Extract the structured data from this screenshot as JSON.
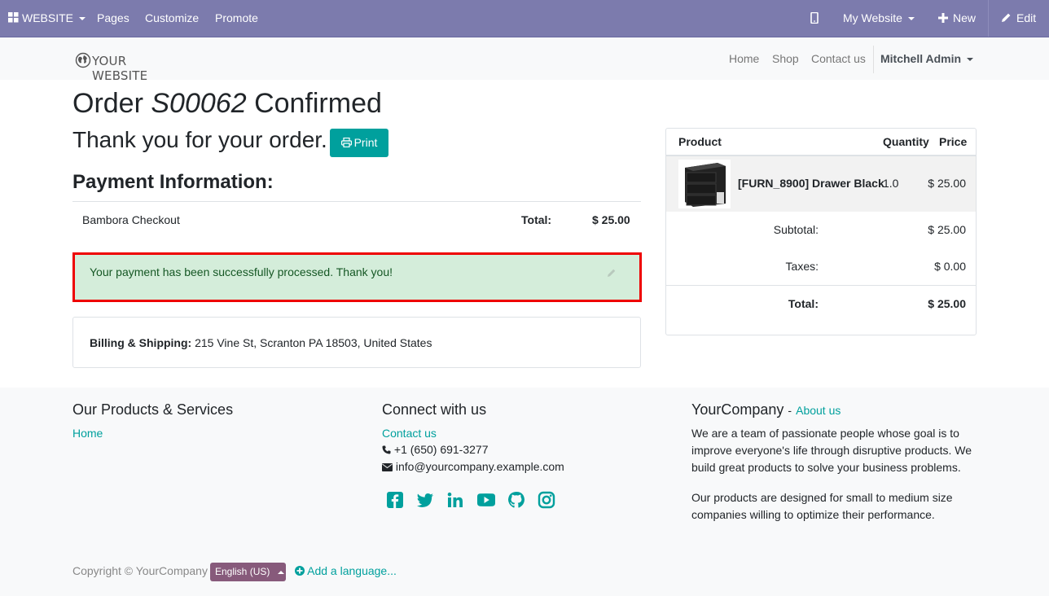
{
  "admin_bar": {
    "website_label": "WEBSITE",
    "pages_label": "Pages",
    "customize_label": "Customize",
    "promote_label": "Promote",
    "my_website_label": "My Website",
    "new_label": "New",
    "edit_label": "Edit"
  },
  "site_nav": {
    "logo_text": "YOUR WEBSITE",
    "links": [
      "Home",
      "Shop",
      "Contact us"
    ],
    "user_label": "Mitchell Admin"
  },
  "order": {
    "title_prefix": "Order",
    "order_number": "S00062",
    "title_suffix": "Confirmed",
    "thanks_text": "Thank you for your order.",
    "print_label": "Print"
  },
  "payment": {
    "heading": "Payment Information:",
    "method": "Bambora Checkout",
    "total_label": "Total:",
    "total_value": "$ 25.00",
    "success_message": "Your payment has been successfully processed. Thank you!"
  },
  "billing": {
    "label": "Billing & Shipping:",
    "address": "215 Vine St, Scranton PA 18503, United States"
  },
  "summary": {
    "headers": {
      "product": "Product",
      "quantity": "Quantity",
      "price": "Price"
    },
    "item": {
      "name": "[FURN_8900] Drawer Black",
      "quantity": "1.0",
      "price": "$ 25.00"
    },
    "subtotal_label": "Subtotal:",
    "subtotal_value": "$ 25.00",
    "taxes_label": "Taxes:",
    "taxes_value": "$ 0.00",
    "total_label": "Total:",
    "total_value": "$ 25.00"
  },
  "footer": {
    "products_heading": "Our Products & Services",
    "products_link": "Home",
    "connect_heading": "Connect with us",
    "contact_link": "Contact us",
    "phone": "+1 (650) 691-3277",
    "email": "info@yourcompany.example.com",
    "company_heading": "YourCompany",
    "company_sep": "-",
    "about_link": "About us",
    "about_text_1": "We are a team of passionate people whose goal is to improve everyone's life through disruptive products. We build great products to solve your business problems.",
    "about_text_2": "Our products are designed for small to medium size companies willing to optimize their performance.",
    "copyright": "Copyright © YourCompany",
    "language": "English (US)",
    "add_language": "Add a language..."
  },
  "colors": {
    "admin_bar": "#7c7bad",
    "primary": "#00a09d",
    "success_bg": "#d4edda",
    "highlight_border": "#ee0000",
    "language_button": "#875a7b"
  },
  "icons": [
    "apps-grid-icon",
    "mobile-icon",
    "plus-icon",
    "pencil-icon",
    "globe-icon",
    "printer-icon",
    "phone-icon",
    "envelope-icon",
    "facebook-icon",
    "twitter-icon",
    "linkedin-icon",
    "youtube-icon",
    "github-icon",
    "instagram-icon",
    "plus-circle-icon"
  ]
}
